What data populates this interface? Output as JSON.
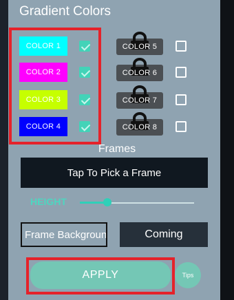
{
  "title": "Gradient Colors",
  "colors": {
    "c1": {
      "label": "COLOR 1",
      "color": "#00ffff",
      "checked": true
    },
    "c2": {
      "label": "COLOR 2",
      "color": "#ff00ff",
      "checked": true
    },
    "c3": {
      "label": "COLOR 3",
      "color": "#c6ff00",
      "checked": true
    },
    "c4": {
      "label": "COLOR 4",
      "color": "#0000ff",
      "checked": true
    },
    "c5": {
      "label": "COLOR 5",
      "locked": true,
      "checked": false
    },
    "c6": {
      "label": "COLOR 6",
      "locked": true,
      "checked": false
    },
    "c7": {
      "label": "COLOR 7",
      "locked": true,
      "checked": false
    },
    "c8": {
      "label": "COLOR 8",
      "locked": true,
      "checked": false
    }
  },
  "frames": {
    "label": "Frames",
    "pick_label": "Tap To Pick a Frame"
  },
  "height": {
    "label": "HEIGHT",
    "slider_fraction": 0.24
  },
  "frame_background": {
    "label": "Frame Background",
    "coming_label": "Coming"
  },
  "apply_label": "APPLY",
  "tips_label": "Tips",
  "theme": {
    "panel": "#8fa3b1",
    "accent": "#43d3b8",
    "highlight": "#e5222a"
  }
}
